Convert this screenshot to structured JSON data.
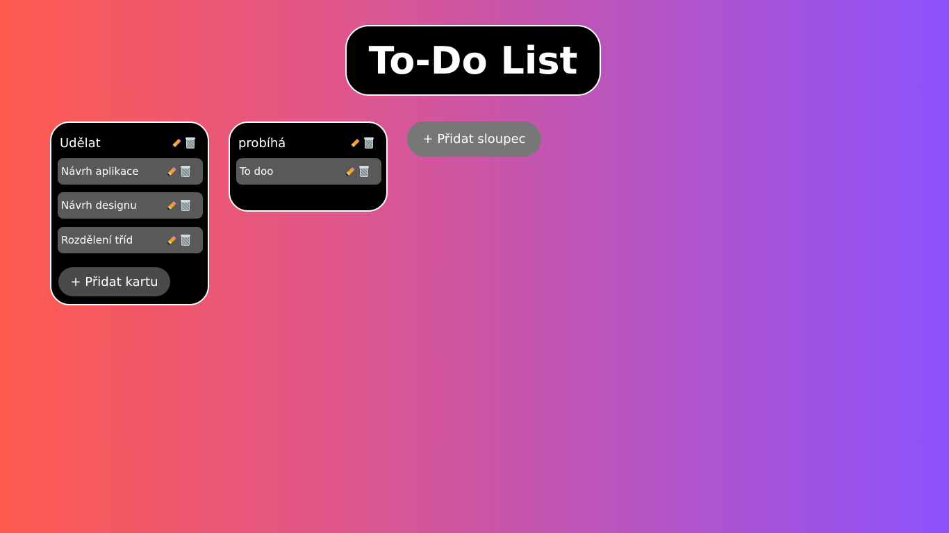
{
  "app": {
    "title": "To-Do List"
  },
  "columns": [
    {
      "title": "Udělat",
      "cards": [
        {
          "label": "Návrh aplikace"
        },
        {
          "label": "Návrh designu"
        },
        {
          "label": "Rozdělení tříd"
        }
      ],
      "add_card_label": "+ Přidat kartu"
    },
    {
      "title": "probíhá",
      "cards": [
        {
          "label": "To doo"
        }
      ]
    }
  ],
  "add_column_label": "+ Přidat sloupec",
  "icons": {
    "edit": "pencil-icon",
    "delete": "trash-icon"
  },
  "colors": {
    "gradient_start": "#ff5a4e",
    "gradient_end": "#8d52fb",
    "panel_bg": "#000000",
    "card_bg": "#595959",
    "add_card_bg": "#4a4a4a",
    "add_column_bg": "#777777"
  }
}
